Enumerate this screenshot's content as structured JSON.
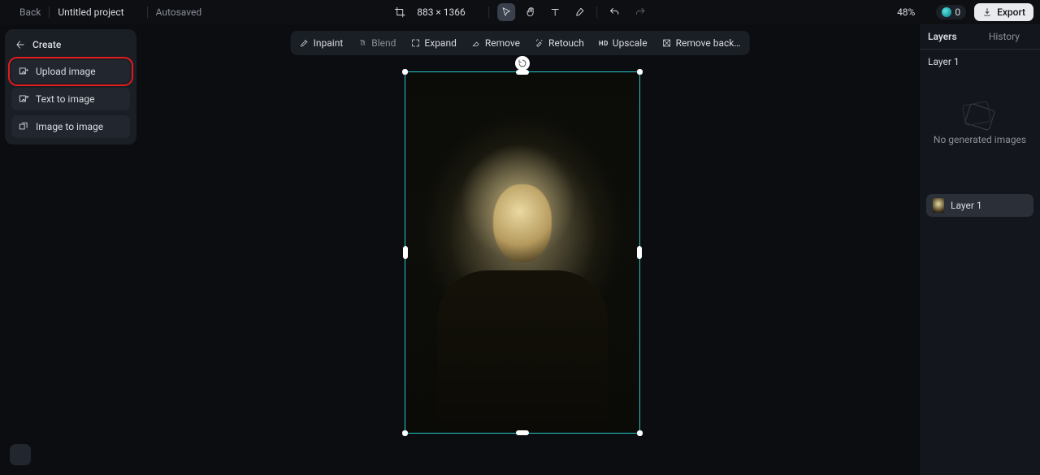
{
  "header": {
    "back_label": "Back",
    "project_name": "Untitled project",
    "autosave_label": "Autosaved",
    "dimensions": "883 × 1366",
    "zoom": "48%",
    "credits": "0",
    "export_label": "Export"
  },
  "left_panel": {
    "title": "Create",
    "items": [
      {
        "label": "Upload image",
        "highlight": true
      },
      {
        "label": "Text to image",
        "highlight": false
      },
      {
        "label": "Image to image",
        "highlight": false
      }
    ]
  },
  "action_bar": {
    "items": [
      {
        "label": "Inpaint",
        "disabled": false
      },
      {
        "label": "Blend",
        "disabled": true
      },
      {
        "label": "Expand",
        "disabled": false
      },
      {
        "label": "Remove",
        "disabled": false
      },
      {
        "label": "Retouch",
        "disabled": false
      },
      {
        "label": "Upscale",
        "disabled": false
      },
      {
        "label": "Remove back…",
        "disabled": false
      }
    ]
  },
  "right_panel": {
    "title": "Layers",
    "history_label": "History",
    "selected_layer": "Layer 1",
    "empty_label": "No generated images",
    "layer_row_label": "Layer 1"
  }
}
